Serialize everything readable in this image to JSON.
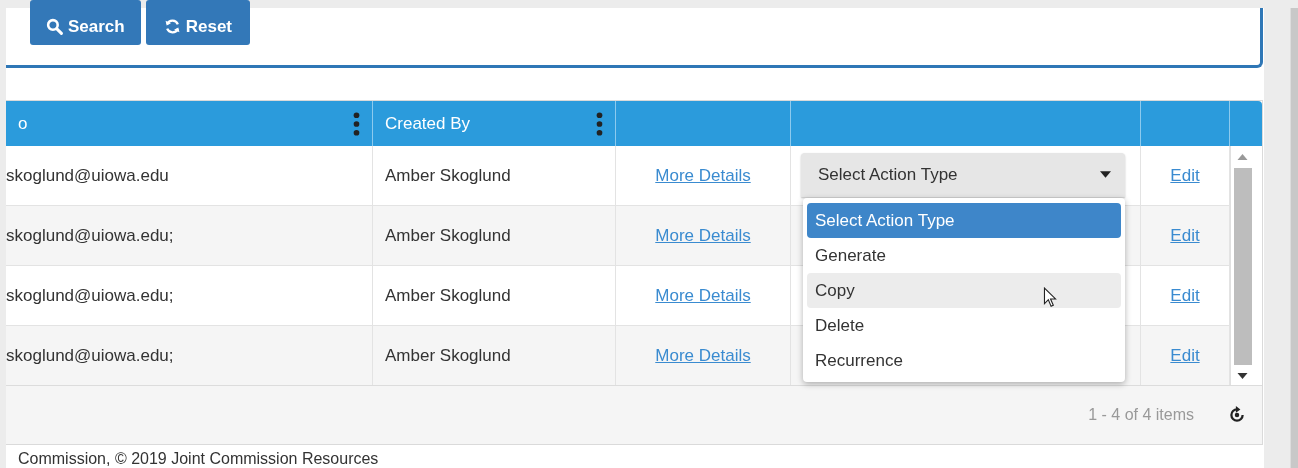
{
  "toolbar": {
    "buttons": [
      {
        "label": "Search",
        "kind": "search"
      },
      {
        "label": "Reset",
        "kind": "reset"
      }
    ]
  },
  "grid": {
    "columns": [
      {
        "label": "o",
        "menu": true
      },
      {
        "label": "Created By",
        "menu": true
      },
      {
        "menu": false
      },
      {
        "menu": false
      },
      {
        "menu": false
      }
    ],
    "rows": [
      {
        "email": "skoglund@uiowa.edu",
        "created_by": "Amber Skoglund",
        "details": "More Details",
        "action": {
          "value": "Select Action Type",
          "open": true
        },
        "edit": "Edit"
      },
      {
        "email": "skoglund@uiowa.edu;",
        "created_by": "Amber Skoglund",
        "details": "More Details",
        "edit": "Edit"
      },
      {
        "email": "skoglund@uiowa.edu;",
        "created_by": "Amber Skoglund",
        "details": "More Details",
        "edit": "Edit"
      },
      {
        "email": "skoglund@uiowa.edu;",
        "created_by": "Amber Skoglund",
        "details": "More Details",
        "edit": "Edit"
      }
    ],
    "action_options": [
      {
        "label": "Select Action Type",
        "selected": true,
        "hovered": false
      },
      {
        "label": "Generate",
        "selected": false,
        "hovered": false
      },
      {
        "label": "Copy",
        "selected": false,
        "hovered": true
      },
      {
        "label": "Delete",
        "selected": false,
        "hovered": false
      },
      {
        "label": "Recurrence",
        "selected": false,
        "hovered": false
      }
    ],
    "pager": "1 - 4 of 4 items"
  },
  "footer": "Commission, © 2019 Joint Commission Resources"
}
